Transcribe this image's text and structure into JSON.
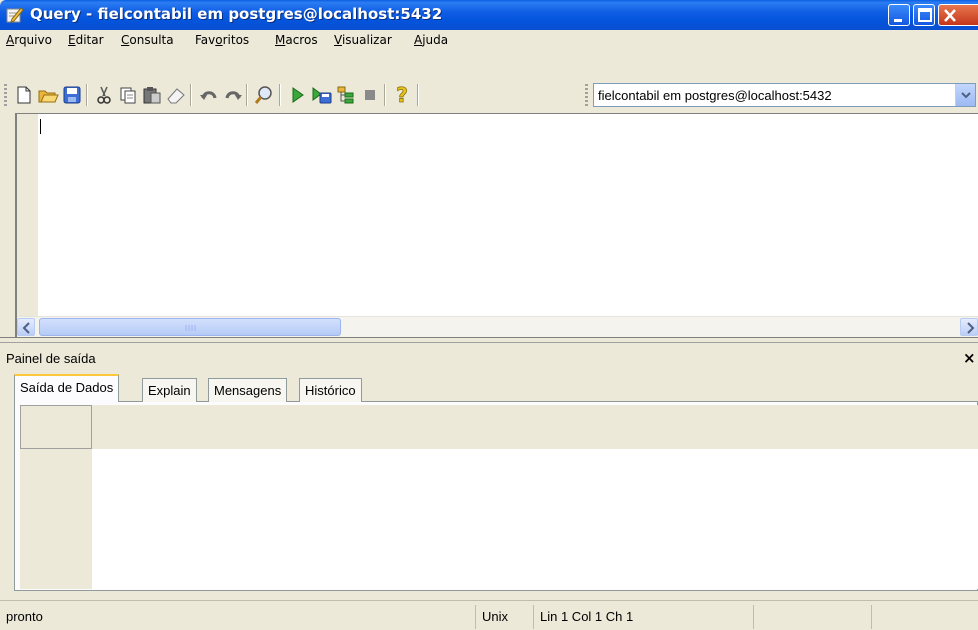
{
  "window": {
    "title": "Query - fielcontabil em postgres@localhost:5432"
  },
  "menu": {
    "items": [
      {
        "label": "Arquivo",
        "accel": "A",
        "rest": "rquivo"
      },
      {
        "label": "Editar",
        "accel": "E",
        "rest": "ditar"
      },
      {
        "label": "Consulta",
        "accel": "C",
        "rest": "onsulta"
      },
      {
        "label": "Favoritos",
        "accel": "",
        "rest": "Favoritos"
      },
      {
        "label": "Macros",
        "accel": "M",
        "rest": "acros"
      },
      {
        "label": "Visualizar",
        "accel": "V",
        "rest": "isualizar"
      },
      {
        "label": "Ajuda",
        "accel": "A",
        "rest": "juda"
      }
    ]
  },
  "toolbar": {
    "icons": [
      "new-file-icon",
      "open-folder-icon",
      "save-icon",
      "cut-icon",
      "copy-icon",
      "paste-icon",
      "eraser-icon",
      "undo-icon",
      "redo-icon",
      "find-icon",
      "execute-icon",
      "execute-to-file-icon",
      "explain-icon",
      "stop-icon",
      "help-icon"
    ],
    "connection": "fielcontabil em postgres@localhost:5432"
  },
  "output_pane": {
    "title": "Painel de saída",
    "tabs": [
      {
        "label": "Saída de Dados",
        "active": true
      },
      {
        "label": "Explain",
        "active": false
      },
      {
        "label": "Mensagens",
        "active": false
      },
      {
        "label": "Histórico",
        "active": false
      }
    ]
  },
  "statusbar": {
    "status": "pronto",
    "line_ending": "Unix",
    "position": "Lin 1 Col 1 Ch 1"
  }
}
